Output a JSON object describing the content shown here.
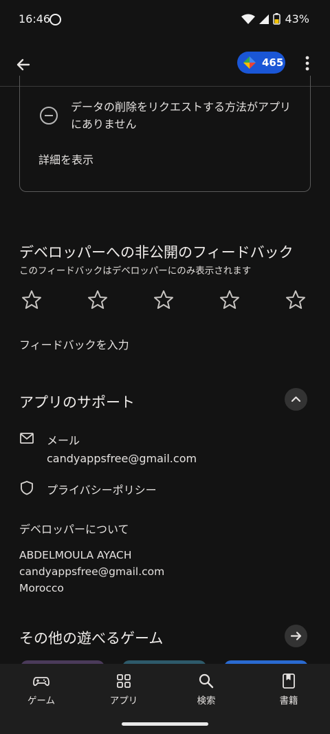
{
  "status_bar": {
    "time": "16:46",
    "battery": "43%"
  },
  "app_bar": {
    "points": "465"
  },
  "data_card": {
    "text": "データの削除をリクエストする方法がアプリにありません",
    "link": "詳細を表示"
  },
  "feedback": {
    "title": "デベロッパーへの非公開のフィードバック",
    "subtitle": "このフィードバックはデベロッパーにのみ表示されます",
    "rating_max": 5,
    "rating_value": 0,
    "input_label": "フィードバックを入力"
  },
  "support": {
    "title": "アプリのサポート",
    "email_label": "メール",
    "email": "candyappsfree@gmail.com",
    "privacy_label": "プライバシーポリシー",
    "about_title": "デベロッパーについて",
    "dev_name": "ABDELMOULA AYACH",
    "dev_email": "candyappsfree@gmail.com",
    "dev_country": "Morocco"
  },
  "more_games": {
    "title": "その他の遊べるゲーム"
  },
  "bottom_nav": [
    {
      "label": "ゲーム",
      "icon": "gamepad-icon"
    },
    {
      "label": "アプリ",
      "icon": "apps-grid-icon"
    },
    {
      "label": "検索",
      "icon": "search-icon"
    },
    {
      "label": "書籍",
      "icon": "book-icon"
    }
  ],
  "colors": {
    "background": "#131313",
    "points_chip": "#1a56d6",
    "nav_background": "#1e1e1e"
  }
}
